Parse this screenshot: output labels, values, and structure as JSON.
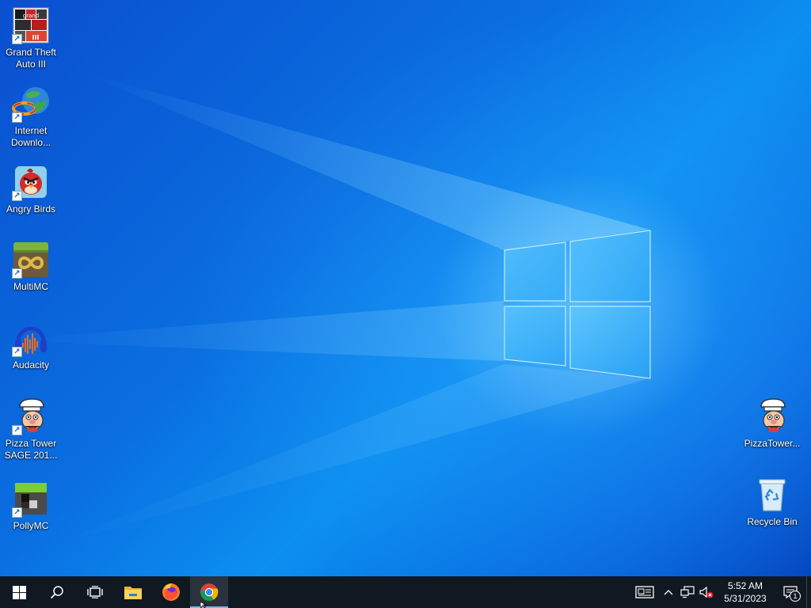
{
  "desktop_icons_left": [
    {
      "id": "gta3",
      "label": "Grand Theft Auto III",
      "icon": "gta3-icon"
    },
    {
      "id": "idm",
      "label": "Internet Downlo...",
      "icon": "internet-download-manager-icon"
    },
    {
      "id": "angrybirds",
      "label": "Angry Birds",
      "icon": "angry-birds-icon"
    },
    {
      "id": "multimc",
      "label": "MultiMC",
      "icon": "multimc-icon"
    },
    {
      "id": "audacity",
      "label": "Audacity",
      "icon": "audacity-icon"
    },
    {
      "id": "pizzatower-sage",
      "label": "Pizza Tower SAGE 201...",
      "icon": "pizza-tower-icon"
    },
    {
      "id": "pollymc",
      "label": "PollyMC",
      "icon": "pollymc-icon"
    }
  ],
  "desktop_icons_right": [
    {
      "id": "pizzatower",
      "label": "PizzaTower...",
      "icon": "pizza-tower-icon"
    },
    {
      "id": "recyclebin",
      "label": "Recycle Bin",
      "icon": "recycle-bin-icon"
    }
  ],
  "taskbar": {
    "buttons": [
      {
        "name": "start-button",
        "icon": "windows-logo-icon"
      },
      {
        "name": "search-button",
        "icon": "search-icon"
      },
      {
        "name": "task-view-button",
        "icon": "task-view-icon"
      },
      {
        "name": "file-explorer-button",
        "icon": "folder-icon"
      },
      {
        "name": "firefox-button",
        "icon": "firefox-icon"
      },
      {
        "name": "chrome-button",
        "icon": "chrome-icon",
        "active": true
      }
    ],
    "tray": {
      "icons": [
        "news-and-interests-icon",
        "chevron-up-icon",
        "network-icon",
        "volume-muted-icon"
      ],
      "time": "5:52 AM",
      "date": "5/31/2023",
      "notification_count": "1"
    }
  },
  "colors": {
    "taskbar_bg": "#101822",
    "active_indicator": "#76b9ed",
    "wallpaper_blue": "#0a6fe0"
  }
}
